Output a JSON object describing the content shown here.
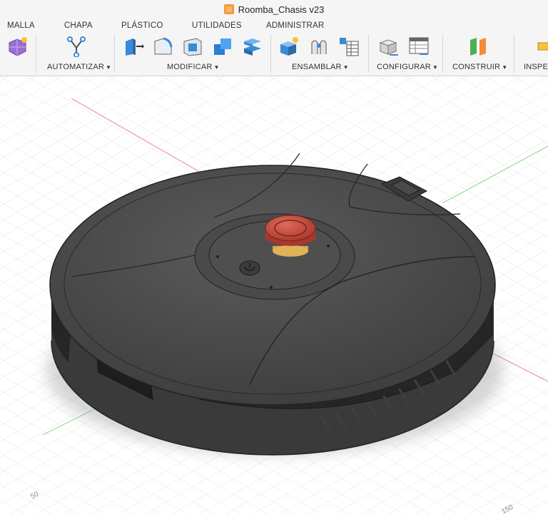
{
  "window": {
    "title": "Roomba_Chasis v23"
  },
  "tabs": [
    "MALLA",
    "CHAPA",
    "PLÁSTICO",
    "UTILIDADES",
    "ADMINISTRAR"
  ],
  "groups": {
    "automatizar": "AUTOMATIZAR",
    "modificar": "MODIFICAR",
    "ensamblar": "ENSAMBLAR",
    "configurar": "CONFIGURAR",
    "construir": "CONSTRUIR",
    "inspeccionar": "INSPEC"
  },
  "viewport": {
    "axis_label_left": "50",
    "axis_label_right": "150"
  },
  "colors": {
    "ribbon_bg": "#f5f5f5",
    "body_dark": "#4a4a4a",
    "bumper": "#2a2a2a",
    "estop_red": "#c84a3c",
    "estop_yellow": "#e0b25a"
  }
}
